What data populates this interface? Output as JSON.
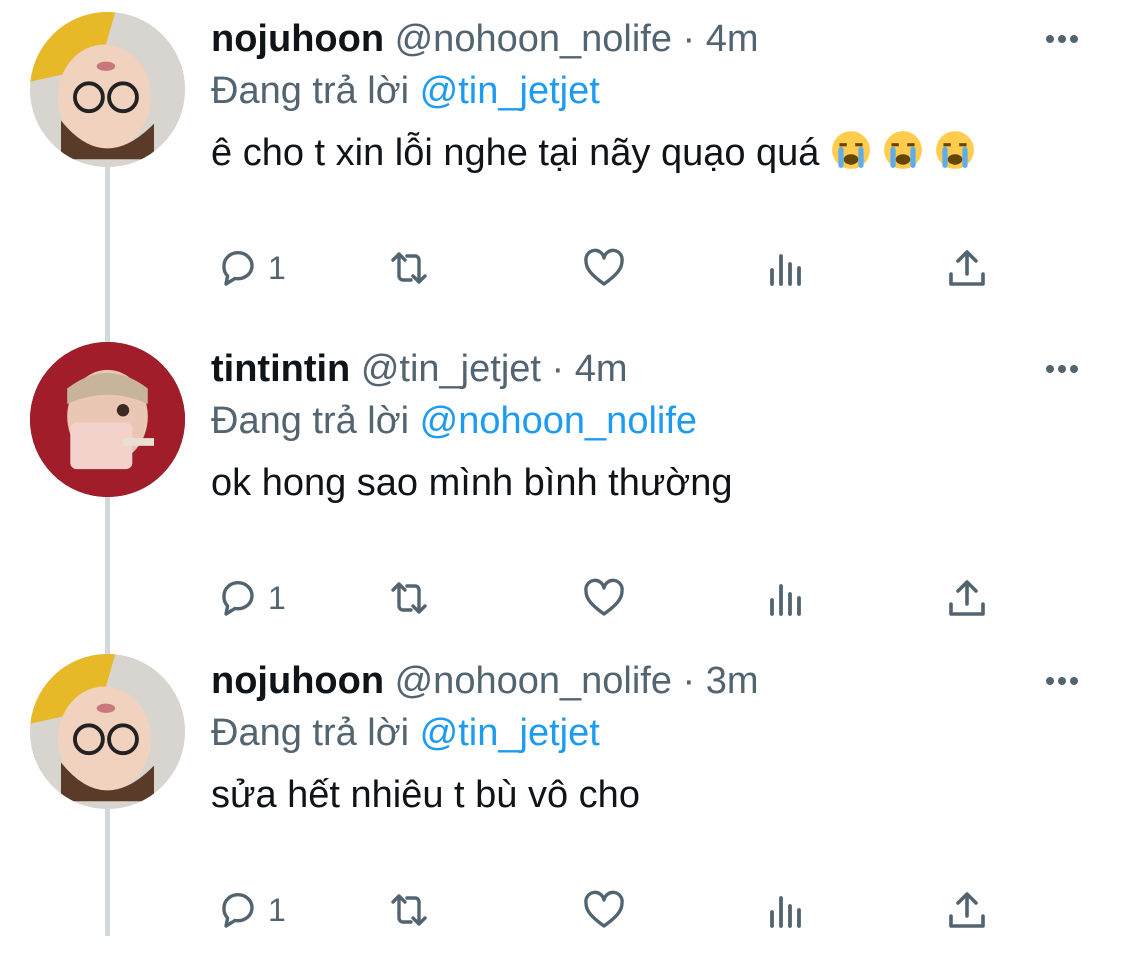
{
  "tweets": [
    {
      "name": "nojuhoon",
      "handle": "@nohoon_nolife",
      "separator": "·",
      "time": "4m",
      "replying_prefix": "Đang trả lời",
      "replying_to": "@tin_jetjet",
      "text": "ê cho t xin lỗi nghe tại nãy quạo quá",
      "emojis": [
        "loudly-crying-face",
        "loudly-crying-face",
        "loudly-crying-face"
      ],
      "reply_count": "1"
    },
    {
      "name": "tintintin",
      "handle": "@tin_jetjet",
      "separator": "·",
      "time": "4m",
      "replying_prefix": "Đang trả lời",
      "replying_to": "@nohoon_nolife",
      "text": "ok hong sao mình bình thường",
      "emojis": [],
      "reply_count": "1"
    },
    {
      "name": "nojuhoon",
      "handle": "@nohoon_nolife",
      "separator": "·",
      "time": "3m",
      "replying_prefix": "Đang trả lời",
      "replying_to": "@tin_jetjet",
      "text": "sửa hết nhiêu t bù vô cho",
      "emojis": [],
      "reply_count": "1"
    }
  ],
  "colors": {
    "text": "#0f1419",
    "secondary": "#536471",
    "link": "#1d9bf0",
    "thread_line": "#cfd9de"
  }
}
